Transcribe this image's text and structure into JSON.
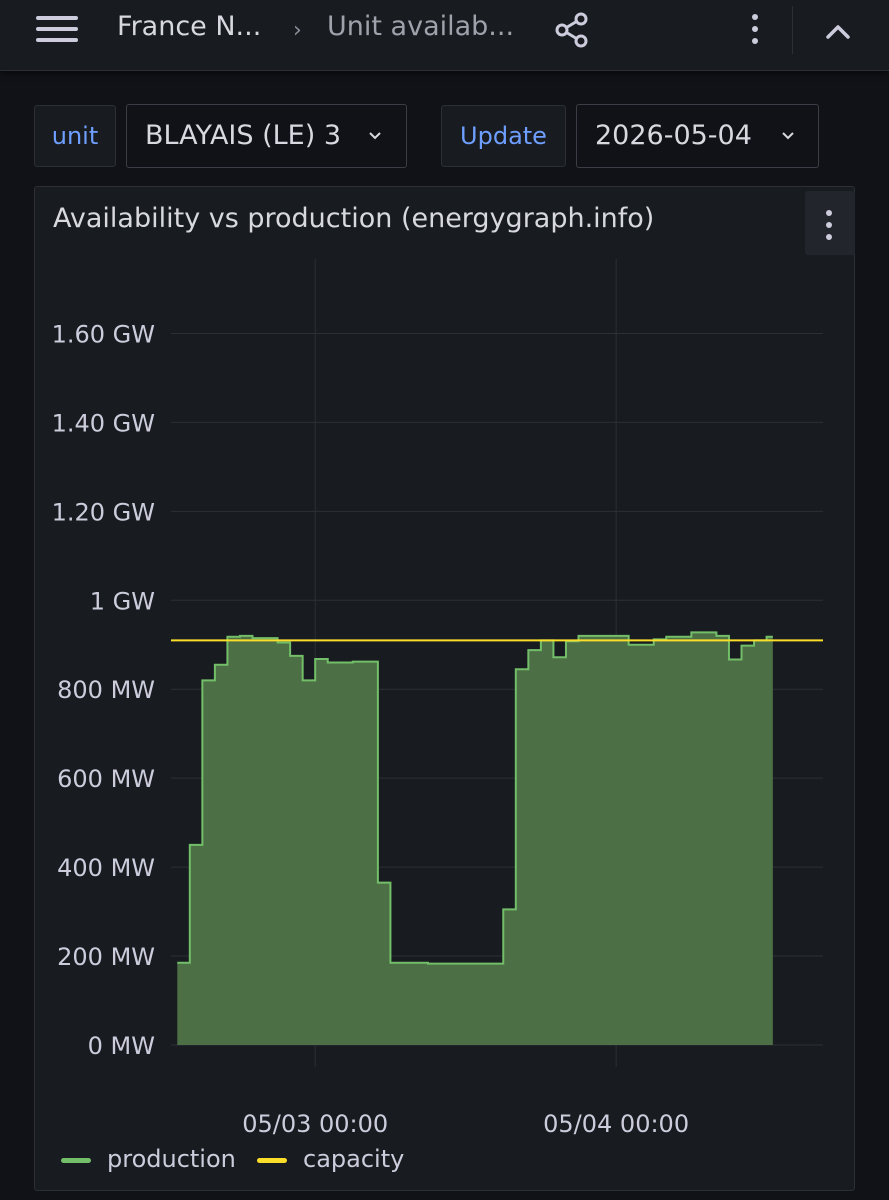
{
  "breadcrumb": {
    "home": "France N...",
    "separator": "›",
    "current": "Unit availab..."
  },
  "icons": {
    "menu": "hamburger-icon",
    "share": "share-icon",
    "more": "kebab-icon",
    "collapse": "chevron-up-icon"
  },
  "variables": {
    "unit": {
      "label": "unit",
      "value": "BLAYAIS (LE) 3"
    },
    "update": {
      "label": "Update",
      "value": "2026-05-04"
    }
  },
  "panel": {
    "title": "Availability vs production (energygraph.info)"
  },
  "colors": {
    "production_line": "#73bf69",
    "production_fill": "#4d6f45",
    "capacity": "#fade2a",
    "grid": "#2c2f36",
    "axis_text": "#ccccdc"
  },
  "chart_data": {
    "type": "area",
    "title": "Availability vs production (energygraph.info)",
    "xlabel": "",
    "ylabel": "",
    "y_unit": "MW",
    "ylim": [
      0,
      1700
    ],
    "yticks": [
      0,
      200,
      400,
      600,
      800,
      1000,
      1200,
      1400,
      1600
    ],
    "ytick_labels": [
      "0 MW",
      "200 MW",
      "400 MW",
      "600 MW",
      "800 MW",
      "1 GW",
      "1.20 GW",
      "1.40 GW",
      "1.60 GW"
    ],
    "xlim": [
      "2026-05-02 12:30",
      "2026-05-04 16:30"
    ],
    "xticks": [
      "2026-05-03 00:00",
      "2026-05-04 00:00"
    ],
    "xtick_labels": [
      "05/03 00:00",
      "05/04 00:00"
    ],
    "grid": true,
    "legend_position": "bottom-left",
    "series": [
      {
        "name": "production",
        "color": "#73bf69",
        "step": true,
        "fill": true,
        "points": [
          [
            "2026-05-02 13:00",
            185
          ],
          [
            "2026-05-02 14:00",
            450
          ],
          [
            "2026-05-02 15:00",
            820
          ],
          [
            "2026-05-02 16:00",
            855
          ],
          [
            "2026-05-02 17:00",
            918
          ],
          [
            "2026-05-02 18:00",
            920
          ],
          [
            "2026-05-02 19:00",
            915
          ],
          [
            "2026-05-02 21:00",
            905
          ],
          [
            "2026-05-02 22:00",
            875
          ],
          [
            "2026-05-02 23:00",
            820
          ],
          [
            "2026-05-03 00:00",
            868
          ],
          [
            "2026-05-03 01:00",
            860
          ],
          [
            "2026-05-03 03:00",
            862
          ],
          [
            "2026-05-03 05:00",
            365
          ],
          [
            "2026-05-03 06:00",
            185
          ],
          [
            "2026-05-03 09:00",
            183
          ],
          [
            "2026-05-03 12:00",
            183
          ],
          [
            "2026-05-03 15:00",
            305
          ],
          [
            "2026-05-03 16:00",
            845
          ],
          [
            "2026-05-03 17:00",
            888
          ],
          [
            "2026-05-03 18:00",
            910
          ],
          [
            "2026-05-03 19:00",
            872
          ],
          [
            "2026-05-03 20:00",
            908
          ],
          [
            "2026-05-03 21:00",
            920
          ],
          [
            "2026-05-04 01:00",
            900
          ],
          [
            "2026-05-04 03:00",
            912
          ],
          [
            "2026-05-04 04:00",
            918
          ],
          [
            "2026-05-04 06:00",
            928
          ],
          [
            "2026-05-04 08:00",
            920
          ],
          [
            "2026-05-04 09:00",
            867
          ],
          [
            "2026-05-04 10:00",
            898
          ],
          [
            "2026-05-04 11:00",
            910
          ],
          [
            "2026-05-04 12:00",
            918
          ],
          [
            "2026-05-04 12:30",
            918
          ]
        ]
      },
      {
        "name": "capacity",
        "color": "#fade2a",
        "step": false,
        "fill": false,
        "points": [
          [
            "2026-05-02 12:30",
            910
          ],
          [
            "2026-05-04 16:30",
            910
          ]
        ]
      }
    ]
  }
}
